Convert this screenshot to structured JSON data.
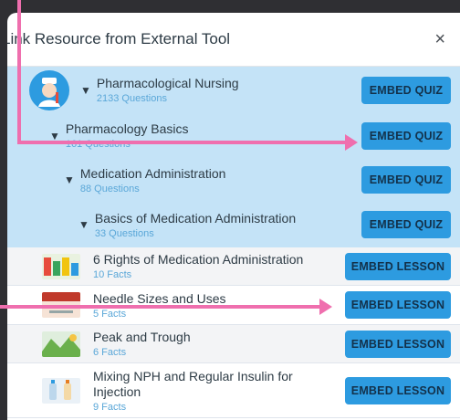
{
  "dialog": {
    "title": "Link Resource from External Tool",
    "close_symbol": "×"
  },
  "quizzes": [
    {
      "name": "Pharmacological Nursing",
      "count": "2133 Questions",
      "button": "EMBED QUIZ"
    },
    {
      "name": "Pharmacology Basics",
      "count": "161 Questions",
      "button": "EMBED QUIZ"
    },
    {
      "name": "Medication Administration",
      "count": "88 Questions",
      "button": "EMBED QUIZ"
    },
    {
      "name": "Basics of Medication Administration",
      "count": "33 Questions",
      "button": "EMBED QUIZ"
    }
  ],
  "lessons": [
    {
      "name": "6 Rights of Medication Administration",
      "count": "10 Facts",
      "button": "EMBED LESSON"
    },
    {
      "name": "Needle Sizes and Uses",
      "count": "5 Facts",
      "button": "EMBED LESSON"
    },
    {
      "name": "Peak and Trough",
      "count": "6 Facts",
      "button": "EMBED LESSON"
    },
    {
      "name": "Mixing NPH and Regular Insulin for Injection",
      "count": "9 Facts",
      "button": "EMBED LESSON"
    }
  ],
  "colors": {
    "accent": "#2d9be0",
    "selected_row": "#c4e3f7",
    "annotation_arrow": "#ef6fae"
  },
  "icons": [
    "nurse-avatar-icon",
    "chevron-down-icon",
    "close-icon",
    "lesson-thumbnail"
  ]
}
